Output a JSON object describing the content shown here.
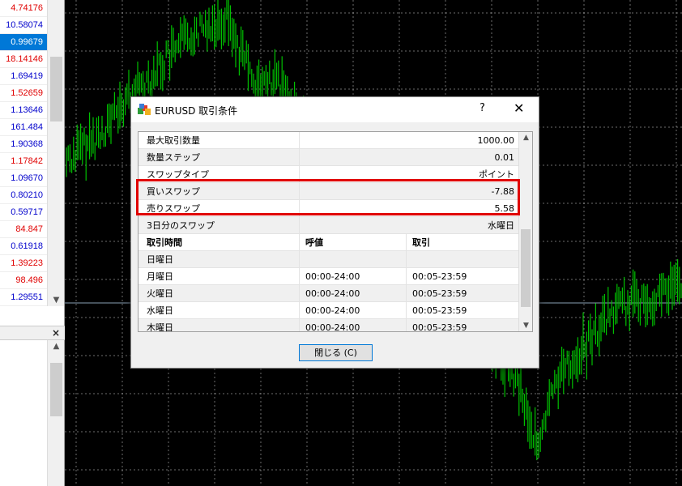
{
  "market_watch": {
    "prices": [
      {
        "value": "4.74176",
        "color": "#e00000"
      },
      {
        "value": "10.58074",
        "color": "#0000cc"
      },
      {
        "value": "0.99679",
        "color": "#ffffff",
        "selected": true
      },
      {
        "value": "18.14146",
        "color": "#e00000"
      },
      {
        "value": "1.69419",
        "color": "#0000cc"
      },
      {
        "value": "1.52659",
        "color": "#e00000"
      },
      {
        "value": "1.13646",
        "color": "#0000cc"
      },
      {
        "value": "161.484",
        "color": "#0000cc"
      },
      {
        "value": "1.90368",
        "color": "#0000cc"
      },
      {
        "value": "1.17842",
        "color": "#e00000"
      },
      {
        "value": "1.09670",
        "color": "#0000cc"
      },
      {
        "value": "0.80210",
        "color": "#0000cc"
      },
      {
        "value": "0.59717",
        "color": "#0000cc"
      },
      {
        "value": "84.847",
        "color": "#e00000"
      },
      {
        "value": "0.61918",
        "color": "#0000cc"
      },
      {
        "value": "1.39223",
        "color": "#e00000"
      },
      {
        "value": "98.496",
        "color": "#e00000"
      },
      {
        "value": "1.29551",
        "color": "#0000cc"
      }
    ],
    "scroll_down_icon": "chevron-down-icon",
    "navigator_close": "×"
  },
  "dialog": {
    "title": "EURUSD 取引条件",
    "help": "?",
    "close": "✕",
    "icon": "terminal-icon",
    "properties": [
      {
        "name": "最大取引数量",
        "value": "1000.00"
      },
      {
        "name": "数量ステップ",
        "value": "0.01"
      },
      {
        "name": "スワップタイプ",
        "value": "ポイント"
      },
      {
        "name": "買いスワップ",
        "value": "-7.88"
      },
      {
        "name": "売りスワップ",
        "value": "5.58"
      },
      {
        "name": "3日分のスワップ",
        "value": "水曜日"
      }
    ],
    "session_headers": [
      "取引時間",
      "呼値",
      "取引"
    ],
    "sessions": [
      {
        "day": "日曜日",
        "quotes": "",
        "trades": ""
      },
      {
        "day": "月曜日",
        "quotes": "00:00-24:00",
        "trades": "00:05-23:59"
      },
      {
        "day": "火曜日",
        "quotes": "00:00-24:00",
        "trades": "00:05-23:59"
      },
      {
        "day": "水曜日",
        "quotes": "00:00-24:00",
        "trades": "00:05-23:59"
      },
      {
        "day": "木曜日",
        "quotes": "00:00-24:00",
        "trades": "00:05-23:59"
      }
    ],
    "close_button": "閉じる (C)",
    "highlight_color": "#e00000"
  },
  "chart": {
    "background": "#000000",
    "candle_color": "#00c000",
    "grid_color": "#c8c8c8"
  }
}
